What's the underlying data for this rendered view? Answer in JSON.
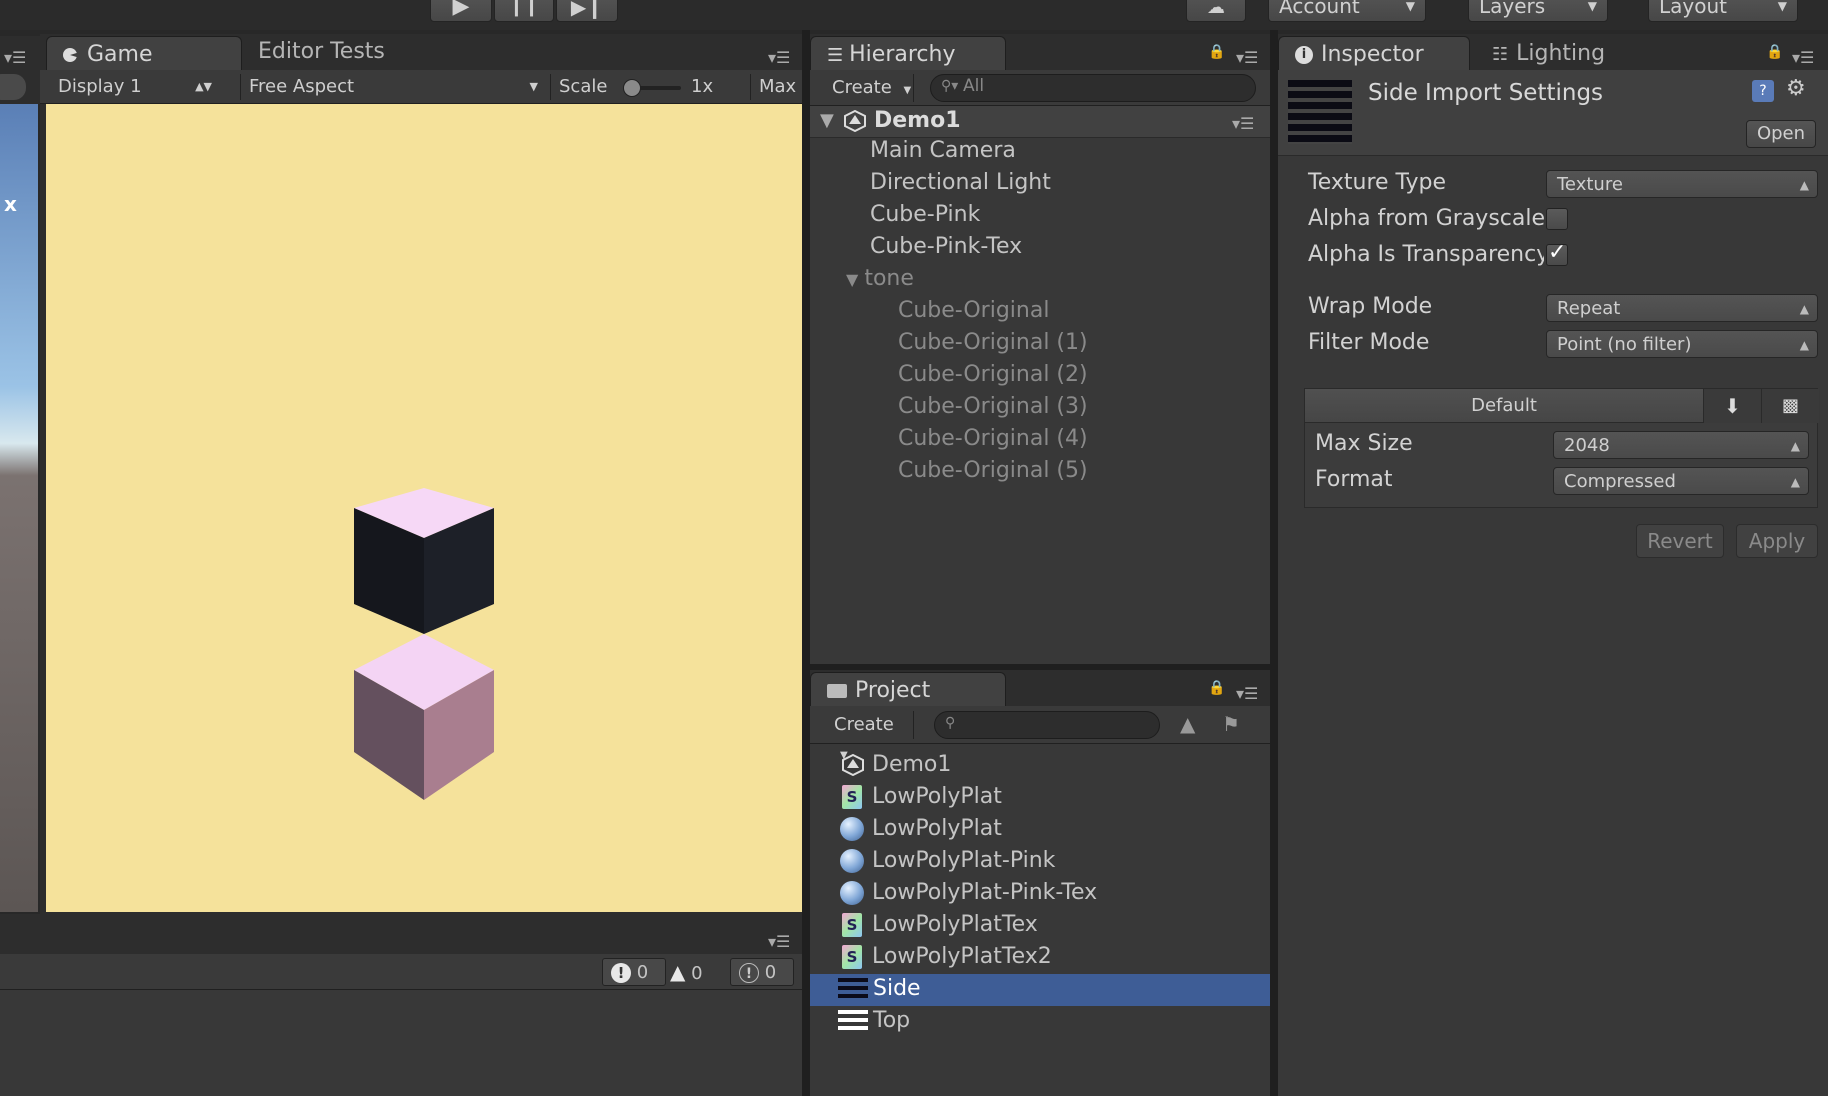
{
  "top_toolbar": {
    "account_label": "Account",
    "layers_label": "Layers",
    "layout_label": "Layout"
  },
  "game_view": {
    "tabs": [
      {
        "label": "Game"
      },
      {
        "label": "Editor Tests"
      }
    ],
    "display_label": "Display 1",
    "aspect_label": "Free Aspect",
    "scale_label": "Scale",
    "scale_value": "1x",
    "maximize_label": "Max",
    "left_x_label": "x",
    "background_color": "#f5e29b"
  },
  "console_bar": {
    "error_count": "0",
    "warning_count": "0",
    "info_count": "0"
  },
  "hierarchy": {
    "tab_label": "Hierarchy",
    "create_label": "Create",
    "search_placeholder": "All",
    "scene_name": "Demo1",
    "items": [
      {
        "label": "Main Camera"
      },
      {
        "label": "Directional Light"
      },
      {
        "label": "Cube-Pink"
      },
      {
        "label": "Cube-Pink-Tex"
      }
    ],
    "group_label": "tone",
    "group_items": [
      {
        "label": "Cube-Original"
      },
      {
        "label": "Cube-Original (1)"
      },
      {
        "label": "Cube-Original (2)"
      },
      {
        "label": "Cube-Original (3)"
      },
      {
        "label": "Cube-Original (4)"
      },
      {
        "label": "Cube-Original (5)"
      }
    ]
  },
  "project": {
    "tab_label": "Project",
    "create_label": "Create",
    "items": [
      {
        "label": "Demo1",
        "icon": "unity-scene-icon"
      },
      {
        "label": "LowPolyPlat",
        "icon": "shader-icon"
      },
      {
        "label": "LowPolyPlat",
        "icon": "material-icon"
      },
      {
        "label": "LowPolyPlat-Pink",
        "icon": "material-icon"
      },
      {
        "label": "LowPolyPlat-Pink-Tex",
        "icon": "material-icon"
      },
      {
        "label": "LowPolyPlatTex",
        "icon": "shader-icon"
      },
      {
        "label": "LowPolyPlatTex2",
        "icon": "shader-icon"
      },
      {
        "label": "Side",
        "icon": "texture-icon",
        "selected": true
      },
      {
        "label": "Top",
        "icon": "texture-icon"
      }
    ]
  },
  "inspector": {
    "tabs": [
      {
        "label": "Inspector"
      },
      {
        "label": "Lighting"
      }
    ],
    "title": "Side Import Settings",
    "open_label": "Open",
    "texture_type_label": "Texture Type",
    "texture_type_value": "Texture",
    "alpha_grayscale_label": "Alpha from Grayscale",
    "alpha_grayscale_checked": false,
    "alpha_transparency_label": "Alpha Is Transparency",
    "alpha_transparency_checked": true,
    "wrap_mode_label": "Wrap Mode",
    "wrap_mode_value": "Repeat",
    "filter_mode_label": "Filter Mode",
    "filter_mode_value": "Point (no filter)",
    "platform_default_label": "Default",
    "max_size_label": "Max Size",
    "max_size_value": "2048",
    "format_label": "Format",
    "format_value": "Compressed",
    "revert_label": "Revert",
    "apply_label": "Apply"
  }
}
